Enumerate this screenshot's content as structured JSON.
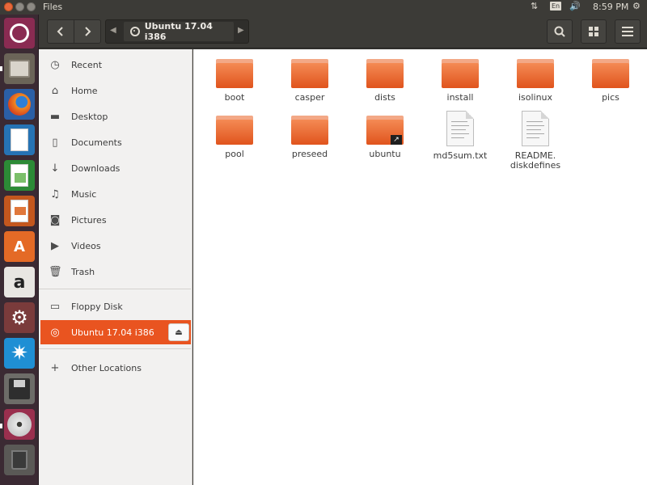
{
  "topbar": {
    "title": "Files",
    "keyboard": "En",
    "clock": "8:59 PM"
  },
  "launcher": {
    "items": [
      "ubuntu-dash-icon",
      "files-icon",
      "firefox-icon",
      "writer-icon",
      "calc-icon",
      "impress-icon",
      "software-center-icon",
      "amazon-icon",
      "system-settings-icon",
      "transmission-icon",
      "floppy-icon",
      "dvd-icon",
      "trash-icon"
    ]
  },
  "header": {
    "path_label": "Ubuntu 17.04 i386"
  },
  "sidebar": {
    "items": [
      {
        "label": "Recent",
        "icon": "clock-icon"
      },
      {
        "label": "Home",
        "icon": "home-icon"
      },
      {
        "label": "Desktop",
        "icon": "folder-icon"
      },
      {
        "label": "Documents",
        "icon": "document-icon"
      },
      {
        "label": "Downloads",
        "icon": "download-icon"
      },
      {
        "label": "Music",
        "icon": "music-icon"
      },
      {
        "label": "Pictures",
        "icon": "camera-icon"
      },
      {
        "label": "Videos",
        "icon": "video-icon"
      },
      {
        "label": "Trash",
        "icon": "trash-icon"
      }
    ],
    "devices": [
      {
        "label": "Floppy Disk",
        "icon": "floppy-icon"
      },
      {
        "label": "Ubuntu 17.04 i386",
        "icon": "disc-icon",
        "active": true
      }
    ],
    "other": {
      "label": "Other Locations",
      "icon": "plus-icon"
    }
  },
  "files": [
    {
      "name": "boot",
      "kind": "folder"
    },
    {
      "name": "casper",
      "kind": "folder"
    },
    {
      "name": "dists",
      "kind": "folder"
    },
    {
      "name": "install",
      "kind": "folder"
    },
    {
      "name": "isolinux",
      "kind": "folder"
    },
    {
      "name": "pics",
      "kind": "folder"
    },
    {
      "name": "pool",
      "kind": "folder"
    },
    {
      "name": "preseed",
      "kind": "folder"
    },
    {
      "name": "ubuntu",
      "kind": "folder-link"
    },
    {
      "name": "md5sum.txt",
      "kind": "text"
    },
    {
      "name": "README.\ndiskdefines",
      "kind": "text"
    }
  ],
  "colors": {
    "accent": "#e95420",
    "launcher_bg": "#3b2a33",
    "panel_bg": "#3c3b37"
  }
}
